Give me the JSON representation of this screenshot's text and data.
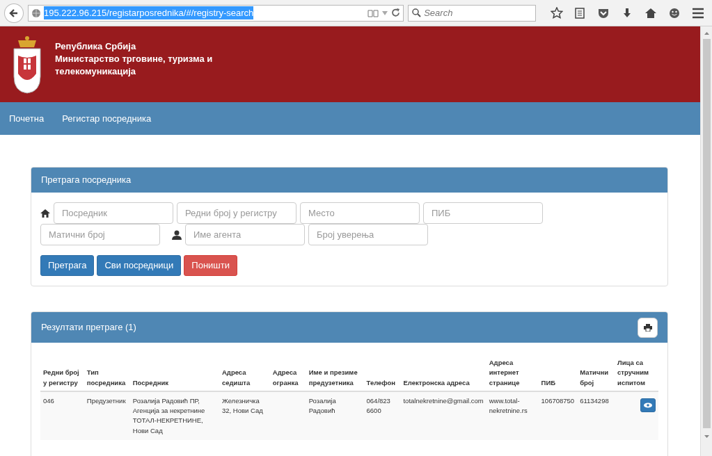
{
  "browser": {
    "url": "195.222.96.215/registarposrednika/#/registry-search",
    "search_placeholder": "Search"
  },
  "header": {
    "lines": [
      "Република Србија",
      "Министарство трговине, туризма и",
      "телекомуникација"
    ]
  },
  "nav": [
    "Почетна",
    "Регистар посредника"
  ],
  "search_panel": {
    "title": "Претрага посредника",
    "rows": [
      [
        {
          "placeholder": "Посредник"
        },
        {
          "placeholder": "Редни број у регистру"
        },
        {
          "placeholder": "Место"
        },
        {
          "placeholder": "ПИБ"
        }
      ],
      [
        {
          "placeholder": "Матични број"
        },
        {
          "placeholder": "Име агента"
        },
        {
          "placeholder": "Број уверења"
        }
      ]
    ],
    "buttons": [
      {
        "label": "Претрага",
        "kind": "primary"
      },
      {
        "label": "Сви посредници",
        "kind": "primary"
      },
      {
        "label": "Поништи",
        "kind": "danger"
      }
    ]
  },
  "results_panel": {
    "title": "Резултати претраге (1)",
    "columns": [
      "Редни број у регистру",
      "Тип посредника",
      "Посредник",
      "Адреса седишта",
      "Адреса огранка",
      "Име и презиме предузетника",
      "Телефон",
      "Електронска адреса",
      "Адреса интернет странице",
      "ПИБ",
      "Матични број",
      "Лица са стручним испитом"
    ],
    "rows": [
      [
        "046",
        "Предузетник",
        "Розалија Радовић ПР, Агенција за некретнине ТОТАЛ-НЕКРЕТНИНЕ, Нови Сад",
        "Железничка 32, Нови Сад",
        "",
        "Розалија Радовић",
        "064/823 6600",
        "totalnekretnine@gmail.com",
        "www.total-nekretnine.rs",
        "106708750",
        "61134298"
      ]
    ]
  }
}
